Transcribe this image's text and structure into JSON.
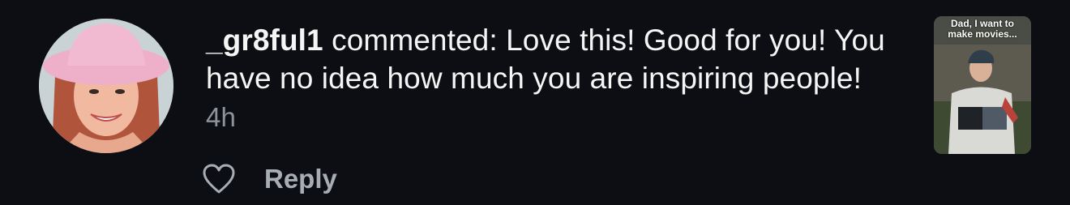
{
  "comment": {
    "username": "_gr8ful1",
    "action": " commented: ",
    "text": "Love this! Good for you! You have no idea how much you are inspiring people!",
    "timestamp": "4h"
  },
  "actions": {
    "like_icon": "heart-outline-icon",
    "reply_label": "Reply"
  },
  "post_thumbnail": {
    "caption": "Dad, I want to\nmake movies..."
  },
  "colors": {
    "background": "#0c0e13",
    "text": "#f5f5f5",
    "muted": "#8e939b"
  }
}
